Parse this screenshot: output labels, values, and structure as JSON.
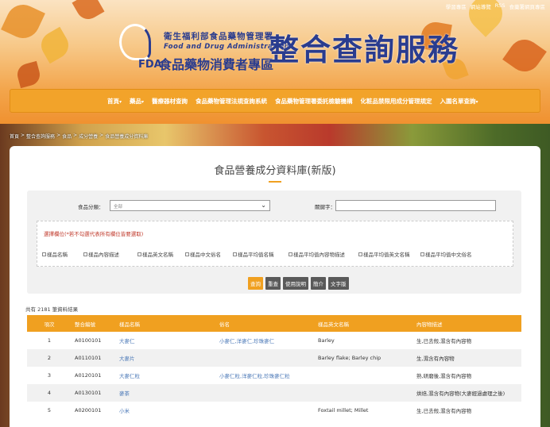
{
  "toplinks": [
    "學習專區",
    "網站導覽",
    "RSS",
    "食藥署網頁專區"
  ],
  "logo": {
    "fda_text": "FDA",
    "org_name": "衛生福利部食品藥物管理署",
    "org_en": "Food and Drug Administration",
    "site_name": "食品藥物消費者專區",
    "big_title": "整合查詢服務"
  },
  "nav": [
    {
      "label": "首頁",
      "dropdown": true
    },
    {
      "label": "藥品",
      "dropdown": true
    },
    {
      "label": "醫療器材查詢",
      "dropdown": false
    },
    {
      "label": "食品藥物管理法規查詢系統",
      "dropdown": false
    },
    {
      "label": "食品藥物管理署委託檢驗機構",
      "dropdown": false
    },
    {
      "label": "化粧品禁限用成分管理規定",
      "dropdown": false
    },
    {
      "label": "入圍名單查詢",
      "dropdown": true
    }
  ],
  "breadcrumb": [
    "首頁",
    "整合查詢服務",
    "食品",
    "成分營養",
    "食品營養成分資料庫"
  ],
  "page": {
    "title": "食品營養成分資料庫(新版)",
    "category_label": "食品分類：",
    "category_value": "全部",
    "keyword_label": "關鍵字：",
    "hint": "選擇欄位(*若不勾選代表所有欄位皆要選取)",
    "checkboxes": [
      "樣品名稱",
      "樣品內容描述",
      "樣品英文名稱",
      "樣品中文俗名",
      "樣品平均值名稱",
      "樣品平均值內容物描述",
      "樣品平均值英文名稱",
      "樣品平均值中文俗名"
    ],
    "buttons": [
      "查詢",
      "重查",
      "使用說明",
      "簡介",
      "文字版"
    ],
    "result_count": "共有 2181 筆資料結果"
  },
  "table": {
    "headers": [
      "項次",
      "整合編號",
      "樣品名稱",
      "俗名",
      "樣品英文名稱",
      "內容物描述"
    ],
    "rows": [
      [
        "1",
        "A0100101",
        "大麥仁",
        "小麥仁,洋麥仁,珍珠麥仁",
        "Barley",
        "生,已去殼,濕含有內容物"
      ],
      [
        "2",
        "A0110101",
        "大麥片",
        "",
        "Barley flake; Barley chip",
        "生,濕含有內容物"
      ],
      [
        "3",
        "A0120101",
        "大麥仁粒",
        "小麥仁粒,洋麥仁粒,珍珠麥仁粒",
        "",
        "熟,研磨後,濕含有內容物"
      ],
      [
        "4",
        "A0130101",
        "麥茶",
        "",
        "",
        "烘焙,濕含有內容物(大麥經過處理之後)"
      ],
      [
        "5",
        "A0200101",
        "小米",
        "",
        "Foxtail millet; Millet",
        "生,已去殼,濕含有內容物"
      ]
    ]
  }
}
